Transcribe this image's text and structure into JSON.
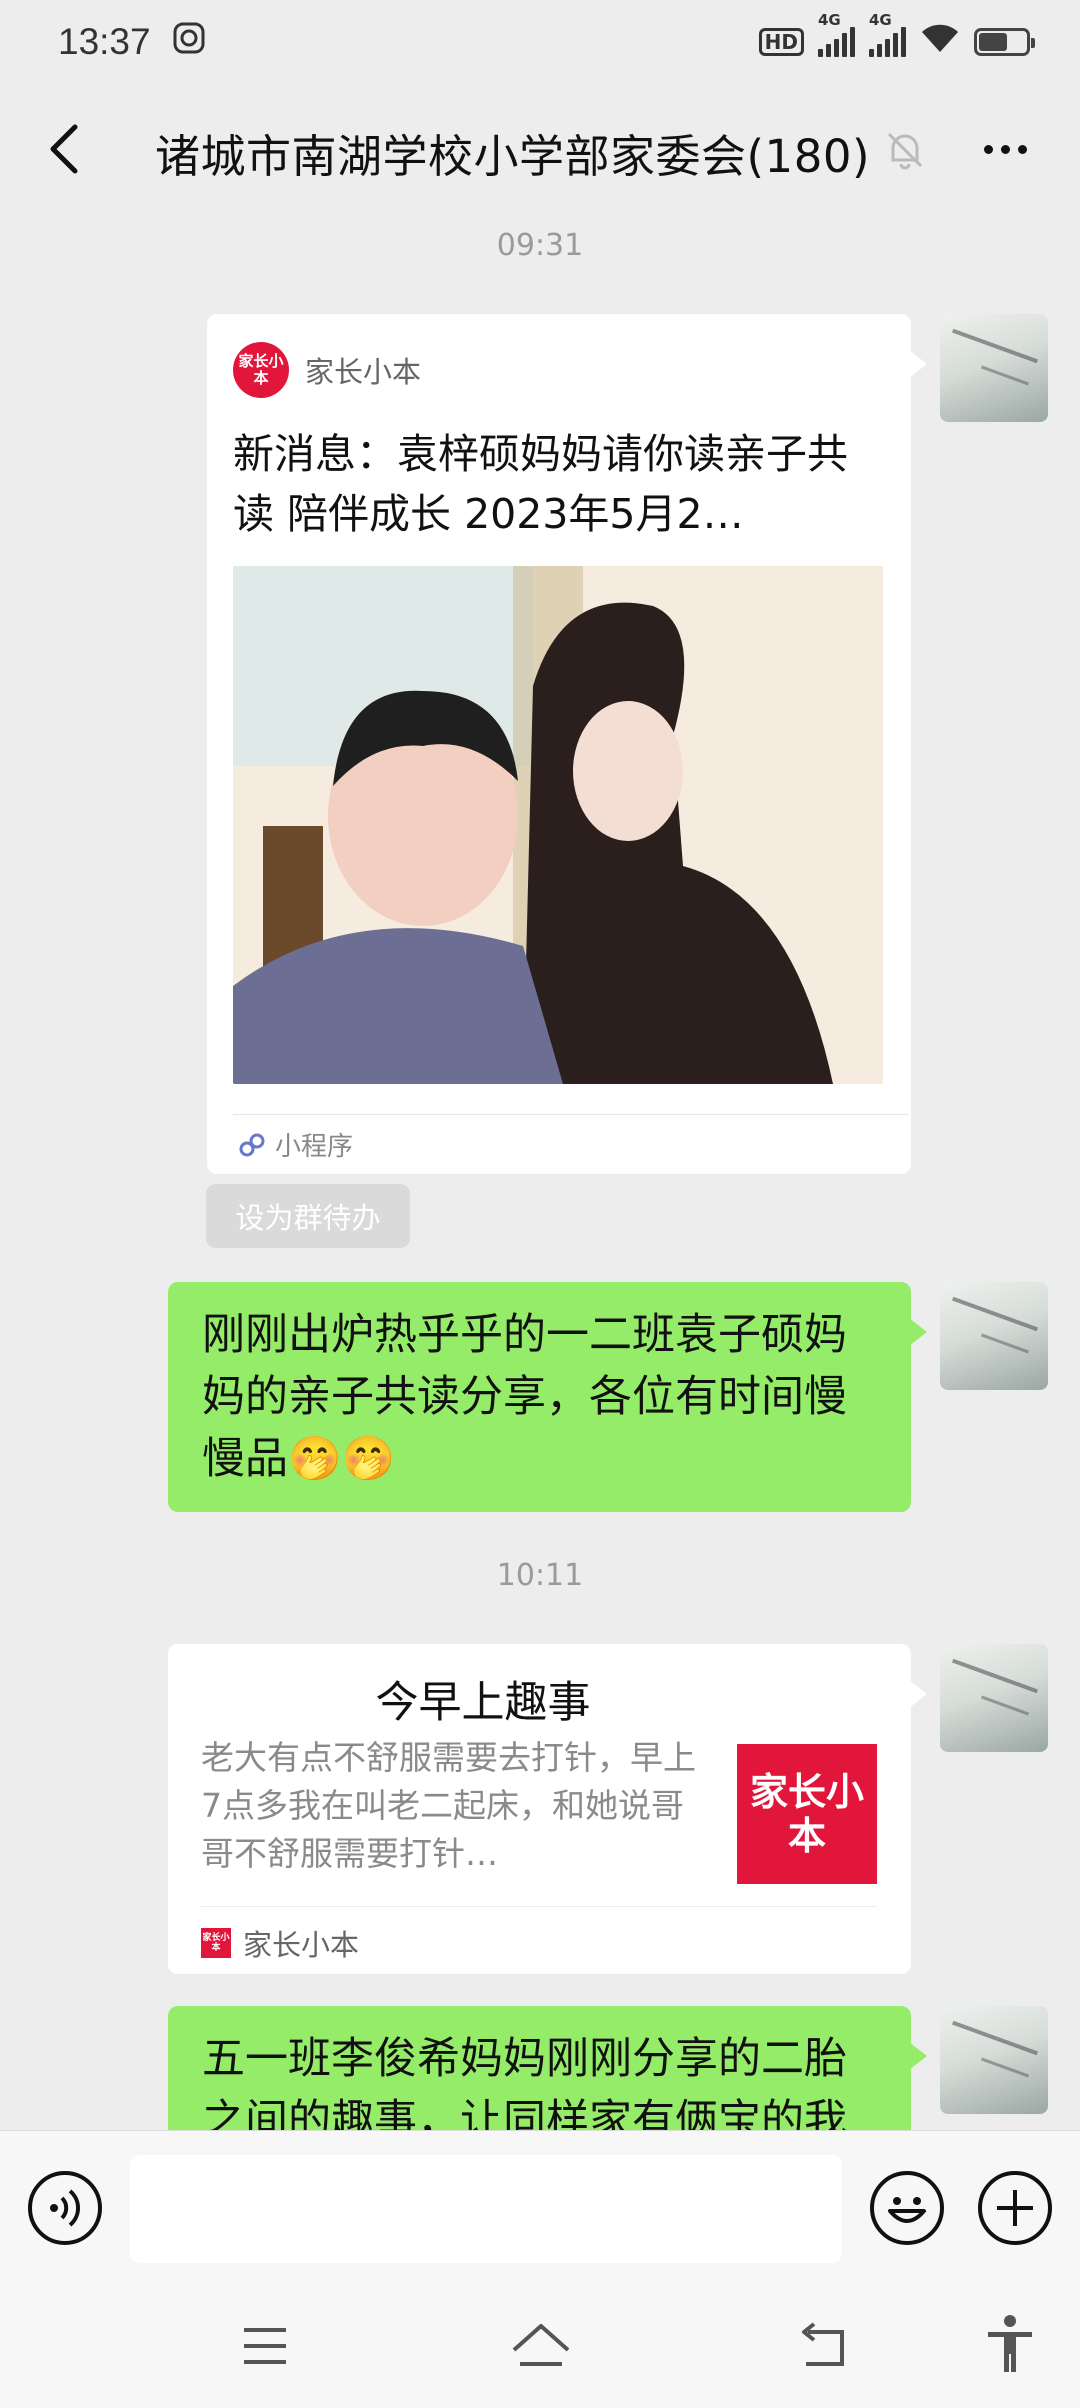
{
  "status_bar": {
    "time": "13:37",
    "hd_label": "HD",
    "network_1": "4G",
    "network_2": "4G",
    "battery_percent": 60
  },
  "header": {
    "title": "诸城市南湖学校小学部家委会(180)",
    "back_icon": "chevron-left-icon",
    "mute_icon": "bell-off-icon",
    "more_icon": "more-dots-icon"
  },
  "messages": {
    "timestamp_1": "09:31",
    "mini_program": {
      "source_name": "家长小本",
      "logo_text": "家长小本",
      "title": "新消息：袁梓硕妈妈请你读亲子共读 陪伴成长 2023年5月2…",
      "footer_label": "小程序"
    },
    "todo_button": "设为群待办",
    "text_1": "刚刚出炉热乎乎的一二班袁子硕妈妈的亲子共读分享，各位有时间慢慢品🤭🤭",
    "timestamp_2": "10:11",
    "article": {
      "title": "今早上趣事",
      "description": "老大有点不舒服需要去打针，早上7点多我在叫老二起床，和她说哥哥不舒服需要打针…",
      "thumb_text": "家长小本",
      "source_name": "家长小本"
    },
    "text_2": "五一班李俊希妈妈刚刚分享的二胎之间的趣事，让同样家有俩宝的我"
  },
  "input_bar": {
    "voice_icon": "voice-icon",
    "emoji_icon": "emoji-icon",
    "plus_icon": "plus-icon"
  },
  "nav_bar": {
    "menu_icon": "menu-icon",
    "home_icon": "home-icon",
    "back_icon": "back-nav-icon",
    "accessibility_icon": "accessibility-icon"
  }
}
